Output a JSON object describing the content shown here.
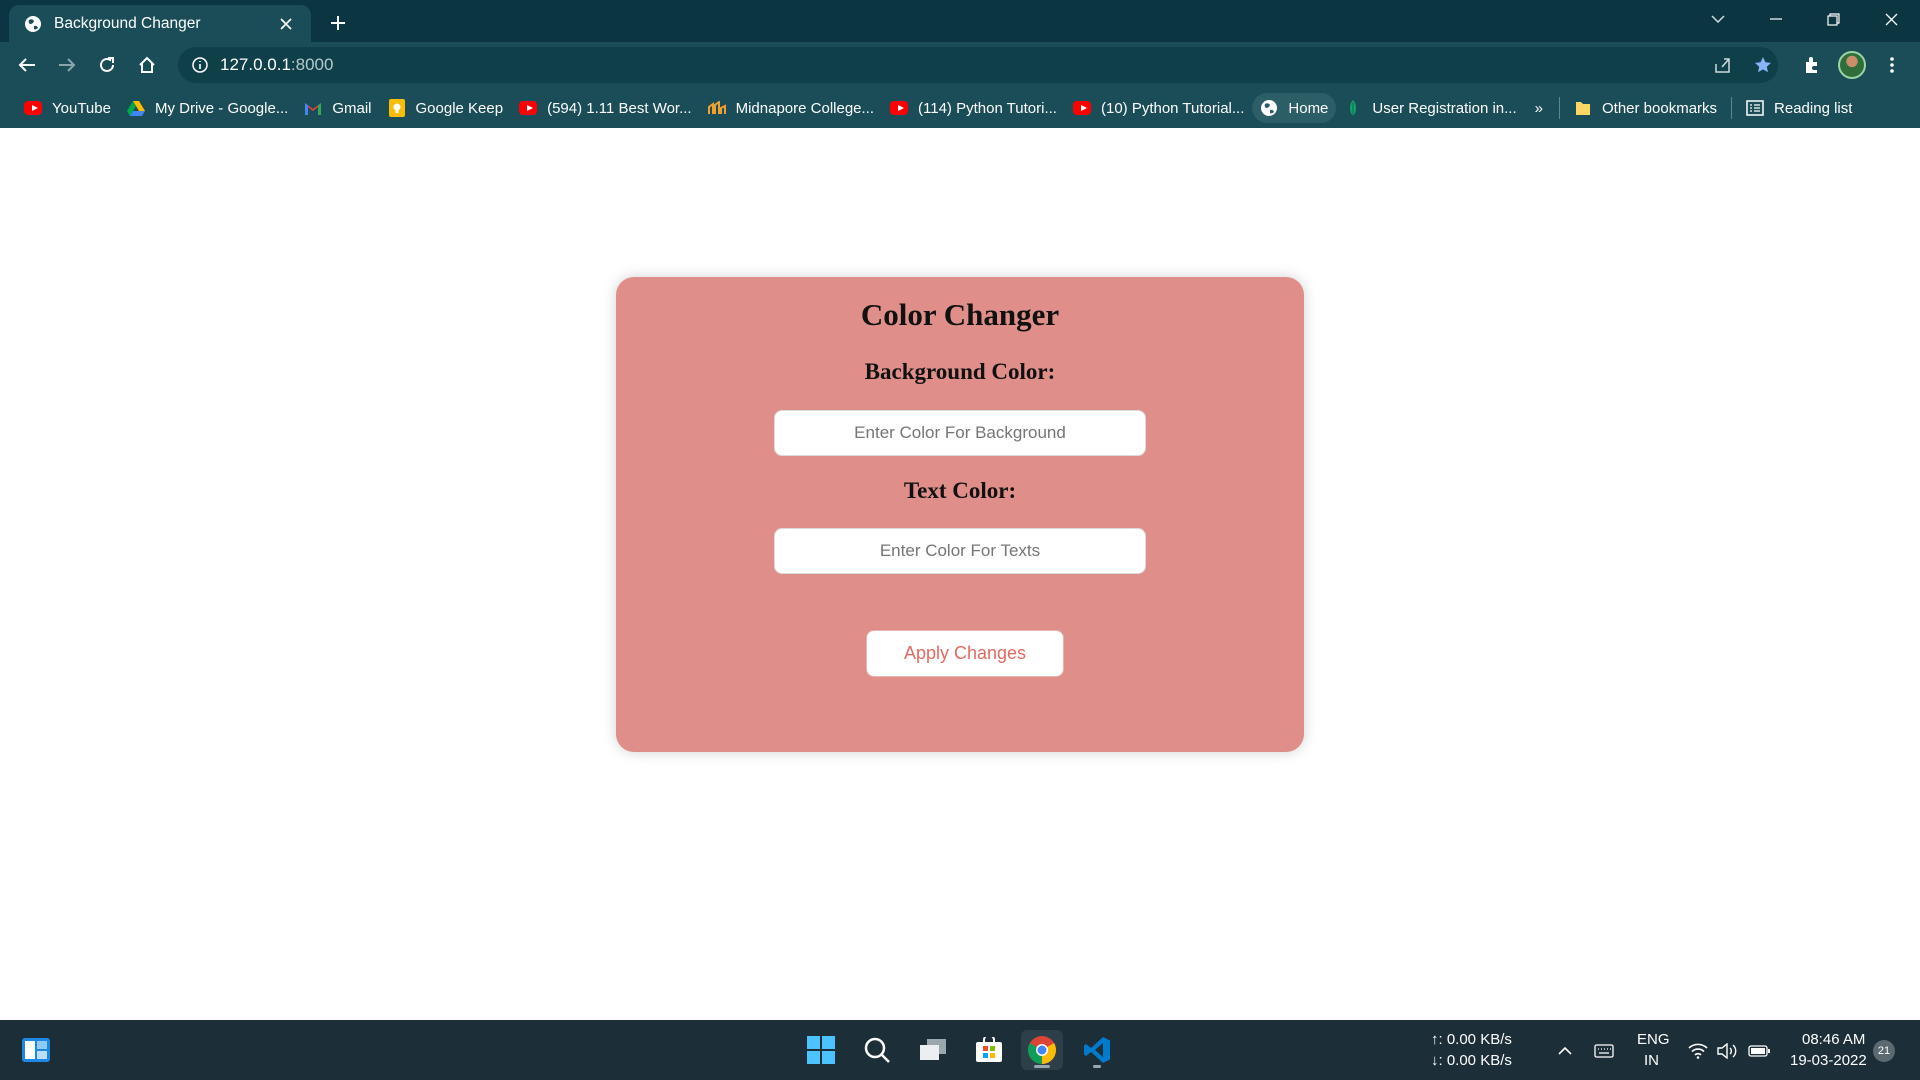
{
  "browser": {
    "tab": {
      "title": "Background Changer"
    },
    "address": {
      "host": "127.0.0.1",
      "port": ":8000"
    },
    "bookmarks": [
      {
        "label": "YouTube",
        "icon": "youtube-icon"
      },
      {
        "label": "My Drive - Google...",
        "icon": "google-drive-icon"
      },
      {
        "label": "Gmail",
        "icon": "gmail-icon"
      },
      {
        "label": "Google Keep",
        "icon": "google-keep-icon"
      },
      {
        "label": "(594) 1.11 Best Wor...",
        "icon": "youtube-icon"
      },
      {
        "label": "Midnapore College...",
        "icon": "college-logo-icon"
      },
      {
        "label": "(114) Python Tutori...",
        "icon": "youtube-icon"
      },
      {
        "label": "(10) Python Tutorial...",
        "icon": "youtube-icon"
      },
      {
        "label": "Home",
        "icon": "globe-icon"
      },
      {
        "label": "User Registration in...",
        "icon": "bookmark-leaf-icon"
      }
    ],
    "overflow": "»",
    "other_bookmarks": "Other bookmarks",
    "reading_list": "Reading list"
  },
  "page": {
    "title": "Color Changer",
    "bg_label": "Background Color:",
    "bg_placeholder": "Enter Color For Background",
    "text_label": "Text Color:",
    "text_placeholder": "Enter Color For Texts",
    "apply_label": "Apply Changes",
    "card_color": "#e08e89",
    "button_text_color": "#e26a62"
  },
  "taskbar": {
    "net_up": "↑: 0.00 KB/s",
    "net_down": "↓: 0.00 KB/s",
    "lang_top": "ENG",
    "lang_bottom": "IN",
    "time": "08:46 AM",
    "date": "19-03-2022",
    "notifications": "21"
  }
}
